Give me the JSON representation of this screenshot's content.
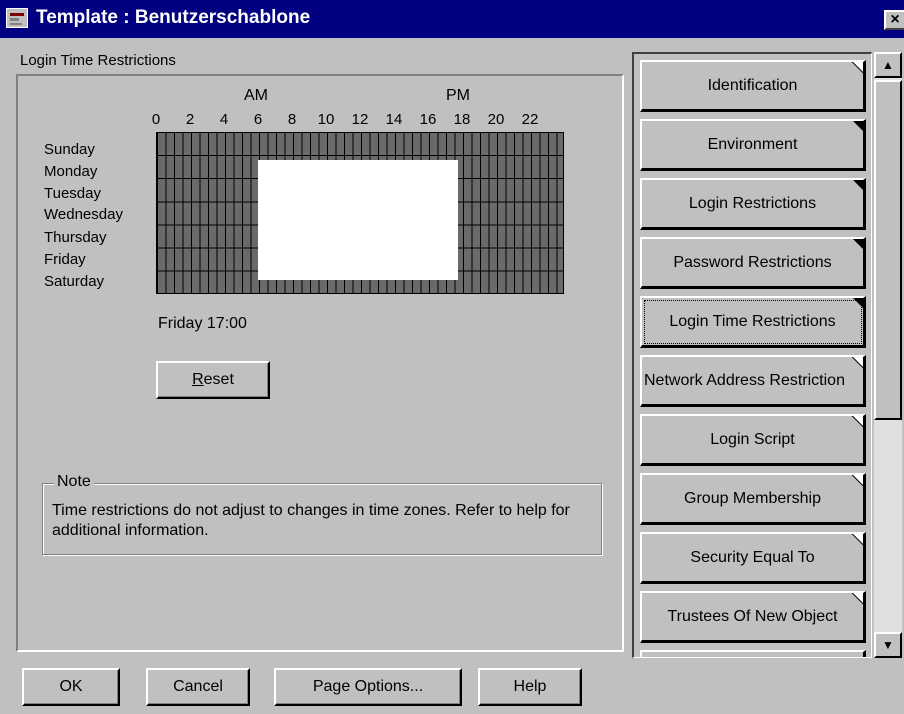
{
  "window": {
    "title": "Template : Benutzerschablone",
    "close_glyph": "×"
  },
  "page": {
    "heading": "Login Time Restrictions",
    "am_label": "AM",
    "pm_label": "PM",
    "hours": [
      "0",
      "2",
      "4",
      "6",
      "8",
      "10",
      "12",
      "14",
      "16",
      "18",
      "20",
      "22"
    ],
    "days": [
      "Sunday",
      "Monday",
      "Tuesday",
      "Wednesday",
      "Thursday",
      "Friday",
      "Saturday"
    ],
    "grid": {
      "allowed_weekdays": [
        "Monday",
        "Tuesday",
        "Wednesday",
        "Thursday",
        "Friday"
      ],
      "allowed_hours": "6-18",
      "colors": {
        "restricted": "#6a6a6a",
        "allowed": "#ffffff"
      }
    },
    "status": "Friday 17:00",
    "reset_label_underlined": "R",
    "reset_label_rest": "eset",
    "note_title": "Note",
    "note_text": "Time restrictions do not adjust to changes in time zones.  Refer to help for additional information."
  },
  "tabs": [
    {
      "label": "Identification",
      "corner": "white"
    },
    {
      "label": "Environment",
      "corner": "black"
    },
    {
      "label": "Login Restrictions",
      "corner": "black"
    },
    {
      "label": "Password Restrictions",
      "corner": "black"
    },
    {
      "label": "Login Time Restrictions",
      "corner": "black",
      "active": true
    },
    {
      "label": "Network Address Restriction",
      "corner": "white"
    },
    {
      "label": "Login Script",
      "corner": "white"
    },
    {
      "label": "Group Membership",
      "corner": "white"
    },
    {
      "label": "Security Equal To",
      "corner": "white"
    },
    {
      "label": "Trustees Of New Object",
      "corner": "white"
    }
  ],
  "scrollbar": {
    "up_glyph": "▲",
    "down_glyph": "▼"
  },
  "buttons": {
    "ok": "OK",
    "cancel": "Cancel",
    "page_options": "Page Options...",
    "help": "Help"
  }
}
